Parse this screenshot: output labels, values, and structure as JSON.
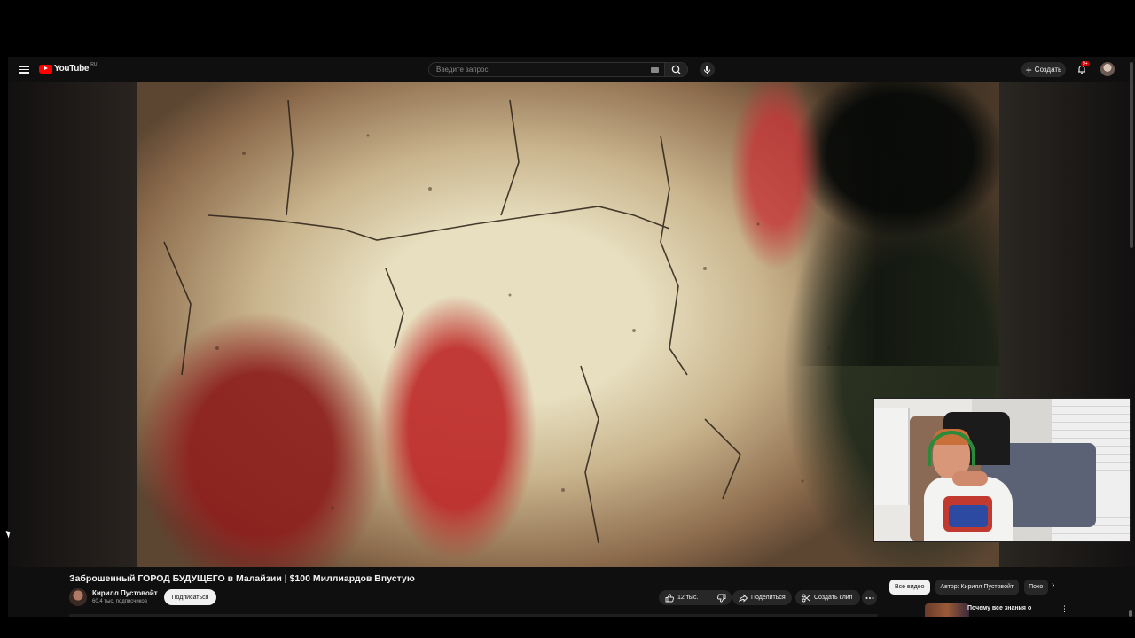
{
  "header": {
    "logo_text": "YouTube",
    "region": "RU",
    "search_placeholder": "Введите запрос",
    "create_label": "Создать",
    "notifications_badge": "9+"
  },
  "video": {
    "title": "Заброшенный ГОРОД БУДУЩЕГО в Малайзии | $100 Миллиардов Впустую",
    "channel_name": "Кирилл Пустовойт",
    "subscribers": "60,4 тыс. подписчиков",
    "subscribe_label": "Подписаться",
    "likes": "12 тыс.",
    "share_label": "Поделиться",
    "clip_label": "Создать клип"
  },
  "recommendations": {
    "chips": [
      "Все видео",
      "Автор: Кирилл Пустовойт",
      "Похо"
    ],
    "first_title": "Почему все знания о"
  },
  "colors": {
    "background": "#0f0f0f",
    "accent_red": "#ff0000",
    "chip_bg": "#272727"
  },
  "icons": [
    "menu-icon",
    "search-icon",
    "keyboard-icon",
    "mic-icon",
    "plus-icon",
    "bell-icon",
    "like-icon",
    "dislike-icon",
    "share-icon",
    "scissors-icon",
    "more-icon",
    "chevron-right-icon"
  ]
}
